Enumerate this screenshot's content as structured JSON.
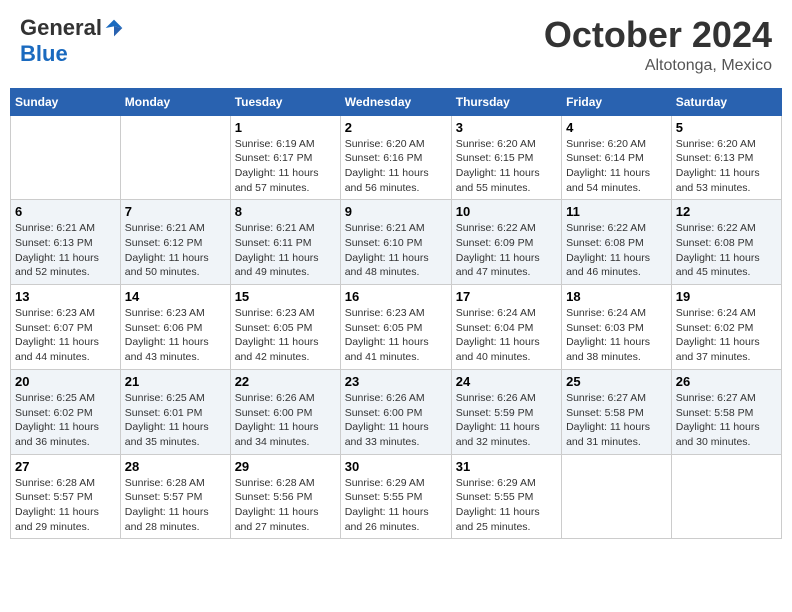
{
  "header": {
    "logo_general": "General",
    "logo_blue": "Blue",
    "month_title": "October 2024",
    "location": "Altotonga, Mexico"
  },
  "weekdays": [
    "Sunday",
    "Monday",
    "Tuesday",
    "Wednesday",
    "Thursday",
    "Friday",
    "Saturday"
  ],
  "weeks": [
    [
      {
        "day": "",
        "info": ""
      },
      {
        "day": "",
        "info": ""
      },
      {
        "day": "1",
        "info": "Sunrise: 6:19 AM\nSunset: 6:17 PM\nDaylight: 11 hours and 57 minutes."
      },
      {
        "day": "2",
        "info": "Sunrise: 6:20 AM\nSunset: 6:16 PM\nDaylight: 11 hours and 56 minutes."
      },
      {
        "day": "3",
        "info": "Sunrise: 6:20 AM\nSunset: 6:15 PM\nDaylight: 11 hours and 55 minutes."
      },
      {
        "day": "4",
        "info": "Sunrise: 6:20 AM\nSunset: 6:14 PM\nDaylight: 11 hours and 54 minutes."
      },
      {
        "day": "5",
        "info": "Sunrise: 6:20 AM\nSunset: 6:13 PM\nDaylight: 11 hours and 53 minutes."
      }
    ],
    [
      {
        "day": "6",
        "info": "Sunrise: 6:21 AM\nSunset: 6:13 PM\nDaylight: 11 hours and 52 minutes."
      },
      {
        "day": "7",
        "info": "Sunrise: 6:21 AM\nSunset: 6:12 PM\nDaylight: 11 hours and 50 minutes."
      },
      {
        "day": "8",
        "info": "Sunrise: 6:21 AM\nSunset: 6:11 PM\nDaylight: 11 hours and 49 minutes."
      },
      {
        "day": "9",
        "info": "Sunrise: 6:21 AM\nSunset: 6:10 PM\nDaylight: 11 hours and 48 minutes."
      },
      {
        "day": "10",
        "info": "Sunrise: 6:22 AM\nSunset: 6:09 PM\nDaylight: 11 hours and 47 minutes."
      },
      {
        "day": "11",
        "info": "Sunrise: 6:22 AM\nSunset: 6:08 PM\nDaylight: 11 hours and 46 minutes."
      },
      {
        "day": "12",
        "info": "Sunrise: 6:22 AM\nSunset: 6:08 PM\nDaylight: 11 hours and 45 minutes."
      }
    ],
    [
      {
        "day": "13",
        "info": "Sunrise: 6:23 AM\nSunset: 6:07 PM\nDaylight: 11 hours and 44 minutes."
      },
      {
        "day": "14",
        "info": "Sunrise: 6:23 AM\nSunset: 6:06 PM\nDaylight: 11 hours and 43 minutes."
      },
      {
        "day": "15",
        "info": "Sunrise: 6:23 AM\nSunset: 6:05 PM\nDaylight: 11 hours and 42 minutes."
      },
      {
        "day": "16",
        "info": "Sunrise: 6:23 AM\nSunset: 6:05 PM\nDaylight: 11 hours and 41 minutes."
      },
      {
        "day": "17",
        "info": "Sunrise: 6:24 AM\nSunset: 6:04 PM\nDaylight: 11 hours and 40 minutes."
      },
      {
        "day": "18",
        "info": "Sunrise: 6:24 AM\nSunset: 6:03 PM\nDaylight: 11 hours and 38 minutes."
      },
      {
        "day": "19",
        "info": "Sunrise: 6:24 AM\nSunset: 6:02 PM\nDaylight: 11 hours and 37 minutes."
      }
    ],
    [
      {
        "day": "20",
        "info": "Sunrise: 6:25 AM\nSunset: 6:02 PM\nDaylight: 11 hours and 36 minutes."
      },
      {
        "day": "21",
        "info": "Sunrise: 6:25 AM\nSunset: 6:01 PM\nDaylight: 11 hours and 35 minutes."
      },
      {
        "day": "22",
        "info": "Sunrise: 6:26 AM\nSunset: 6:00 PM\nDaylight: 11 hours and 34 minutes."
      },
      {
        "day": "23",
        "info": "Sunrise: 6:26 AM\nSunset: 6:00 PM\nDaylight: 11 hours and 33 minutes."
      },
      {
        "day": "24",
        "info": "Sunrise: 6:26 AM\nSunset: 5:59 PM\nDaylight: 11 hours and 32 minutes."
      },
      {
        "day": "25",
        "info": "Sunrise: 6:27 AM\nSunset: 5:58 PM\nDaylight: 11 hours and 31 minutes."
      },
      {
        "day": "26",
        "info": "Sunrise: 6:27 AM\nSunset: 5:58 PM\nDaylight: 11 hours and 30 minutes."
      }
    ],
    [
      {
        "day": "27",
        "info": "Sunrise: 6:28 AM\nSunset: 5:57 PM\nDaylight: 11 hours and 29 minutes."
      },
      {
        "day": "28",
        "info": "Sunrise: 6:28 AM\nSunset: 5:57 PM\nDaylight: 11 hours and 28 minutes."
      },
      {
        "day": "29",
        "info": "Sunrise: 6:28 AM\nSunset: 5:56 PM\nDaylight: 11 hours and 27 minutes."
      },
      {
        "day": "30",
        "info": "Sunrise: 6:29 AM\nSunset: 5:55 PM\nDaylight: 11 hours and 26 minutes."
      },
      {
        "day": "31",
        "info": "Sunrise: 6:29 AM\nSunset: 5:55 PM\nDaylight: 11 hours and 25 minutes."
      },
      {
        "day": "",
        "info": ""
      },
      {
        "day": "",
        "info": ""
      }
    ]
  ]
}
